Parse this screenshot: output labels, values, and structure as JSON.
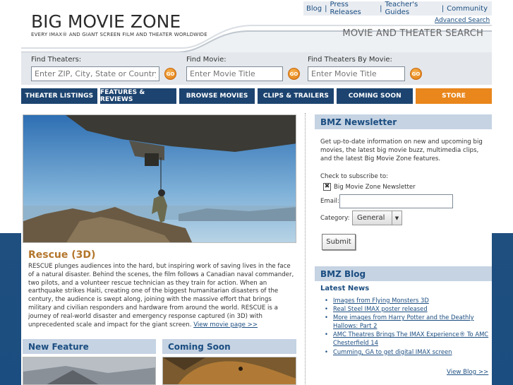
{
  "header": {
    "logo_title": "BIG MOVIE ZONE",
    "logo_tagline": "EVERY IMAX® AND GIANT SCREEN FILM AND THEATER WORLDWIDE",
    "section_title": "MOVIE AND THEATER SEARCH",
    "top_links": [
      "Blog",
      "Press Releases",
      "Teacher's Guides",
      "Community"
    ]
  },
  "search": {
    "theaters_label": "Find Theaters:",
    "theaters_placeholder": "Enter ZIP, City, State or Country",
    "movie_label": "Find Movie:",
    "movie_placeholder": "Enter Movie Title",
    "by_movie_label": "Find Theaters By Movie:",
    "by_movie_placeholder": "Enter Movie Title",
    "go_label": "GO",
    "advanced_label": "Advanced Search"
  },
  "nav": [
    "THEATER LISTINGS",
    "FEATURES & REVIEWS",
    "BROWSE MOVIES",
    "CLIPS & TRAILERS",
    "COMING SOON",
    "STORE"
  ],
  "feature": {
    "title": "Rescue (3D)",
    "text": "RESCUE plunges audiences into the hard, but inspiring work of saving lives in the face of a natural disaster. Behind the scenes, the film follows a Canadian naval commander, two pilots, and a volunteer rescue technician as they train for action. When an earthquake strikes Haiti, creating one of the biggest humanitarian disasters of the century, the audience is swept along, joining with the massive effort that brings military and civilian responders and hardware from around the world. RESCUE is a journey of real-world disaster and emergency response captured (in 3D) with unprecedented scale and impact for the giant screen.",
    "link": "View movie page >>"
  },
  "new_feature": {
    "heading": "New Feature"
  },
  "coming_soon": {
    "heading": "Coming Soon"
  },
  "newsletter": {
    "heading": "BMZ Newsletter",
    "text": "Get up-to-date information on new and upcoming big movies, the latest big movie buzz, multimedia clips, and the latest Big Movie Zone features.",
    "check_label": "Check to subscribe to:",
    "option": "Big Movie Zone Newsletter",
    "email_label": "Email:",
    "category_label": "Category:",
    "category_value": "General",
    "submit": "Submit"
  },
  "blog": {
    "heading": "BMZ Blog",
    "subheading": "Latest News",
    "items": [
      "Images from Flying Monsters 3D",
      "Real Steel IMAX poster released",
      "More images from Harry Potter and the Deathly Hallows: Part 2",
      "AMC Theatres Brings The IMAX Experience® To AMC Chesterfield 14",
      "Cumming, GA to get digital IMAX screen"
    ],
    "view_all": "View Blog >>"
  },
  "colors": {
    "nav_blue": "#1d4470",
    "store_orange": "#e9861c",
    "feature_title": "#b3762b",
    "box_header": "#c5d3e3",
    "link_blue": "#1b4d80"
  }
}
